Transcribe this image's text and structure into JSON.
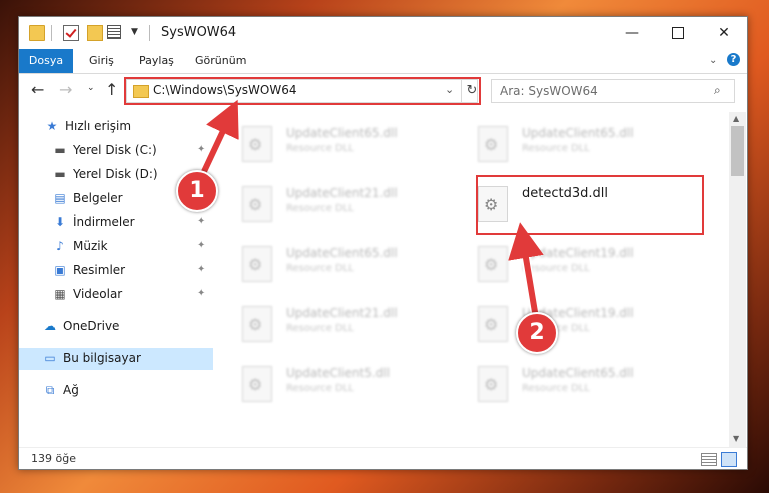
{
  "window": {
    "title": "SysWOW64",
    "controls": {
      "minimize": "—",
      "maximize": "",
      "close": "✕"
    }
  },
  "ribbon": {
    "tabs": [
      "Dosya",
      "Giriş",
      "Paylaş",
      "Görünüm"
    ],
    "help": "?"
  },
  "navigation": {
    "back": "←",
    "forward": "→",
    "recent": "⌄",
    "up": "↑",
    "address": "C:\\Windows\\SysWOW64",
    "address_chevron": "⌄",
    "refresh": "↻",
    "search_placeholder": "Ara: SysWOW64",
    "search_icon": "⌕"
  },
  "sidebar": {
    "items": [
      {
        "label": "Hızlı erişim",
        "icon": "star-icon",
        "glyph": "★",
        "color": "#3a7bd5"
      },
      {
        "label": "Yerel Disk (C:)",
        "icon": "drive-icon",
        "glyph": "▬",
        "color": "#555555",
        "pinned": true
      },
      {
        "label": "Yerel Disk (D:)",
        "icon": "drive-icon",
        "glyph": "▬",
        "color": "#555555",
        "pinned": true
      },
      {
        "label": "Belgeler",
        "icon": "document-icon",
        "glyph": "▤",
        "color": "#3a7bd5",
        "pinned": true
      },
      {
        "label": "İndirmeler",
        "icon": "download-icon",
        "glyph": "⬇",
        "color": "#3a7bd5",
        "pinned": true
      },
      {
        "label": "Müzik",
        "icon": "music-icon",
        "glyph": "♪",
        "color": "#3a7bd5",
        "pinned": true
      },
      {
        "label": "Resimler",
        "icon": "pictures-icon",
        "glyph": "▣",
        "color": "#3a7bd5",
        "pinned": true
      },
      {
        "label": "Videolar",
        "icon": "video-icon",
        "glyph": "▦",
        "color": "#555555",
        "pinned": true
      },
      {
        "label": "OneDrive",
        "icon": "cloud-icon",
        "glyph": "☁",
        "color": "#1979ca"
      },
      {
        "label": "Bu bilgisayar",
        "icon": "computer-icon",
        "glyph": "▭",
        "color": "#3a7bd5",
        "selected": true
      },
      {
        "label": "Ağ",
        "icon": "network-icon",
        "glyph": "⧉",
        "color": "#3a7bd5"
      }
    ],
    "pin_glyph": "📌"
  },
  "files": [
    {
      "name": "UpdateClient65.dll",
      "type": "Resource DLL"
    },
    {
      "name": "UpdateClient65.dll",
      "type": "Resource DLL"
    },
    {
      "name": "UpdateClient21.dll",
      "type": "Resource DLL"
    },
    {
      "name": "detectd3d.dll",
      "type": ""
    },
    {
      "name": "UpdateClient65.dll",
      "type": "Resource DLL"
    },
    {
      "name": "UpdateClient19.dll",
      "type": "Resource DLL"
    },
    {
      "name": "UpdateClient21.dll",
      "type": "Resource DLL"
    },
    {
      "name": "UpdateClient19.dll",
      "type": "Resource DLL"
    },
    {
      "name": "UpdateClient5.dll",
      "type": "Resource DLL"
    },
    {
      "name": "UpdateClient65.dll",
      "type": "Resource DLL"
    }
  ],
  "status": {
    "item_count": "139 öğe"
  },
  "annotations": {
    "step1": "1",
    "step2": "2",
    "highlight_color": "#e13a3a"
  }
}
